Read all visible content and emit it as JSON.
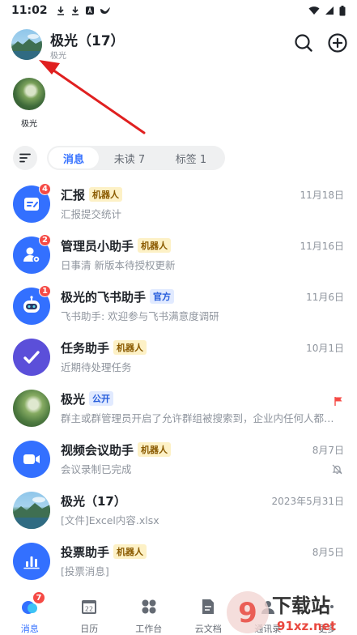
{
  "status_bar": {
    "time": "11:02"
  },
  "header": {
    "title": "极光（17）",
    "subtitle": "极光"
  },
  "story": {
    "name": "极光"
  },
  "filter": {
    "tabs": [
      {
        "label": "消息",
        "active": true
      },
      {
        "label": "未读 7",
        "active": false
      },
      {
        "label": "标签 1",
        "active": false
      }
    ]
  },
  "chats": [
    {
      "name": "汇报",
      "tag": "机器人",
      "date": "11月18日",
      "preview": "汇报提交统计",
      "badge": "4",
      "icon": "report-icon",
      "color": "#3370ff"
    },
    {
      "name": "管理员小助手",
      "tag": "机器人",
      "date": "11月16日",
      "preview": "日事清 新版本待授权更新",
      "badge": "2",
      "icon": "admin-settings-icon",
      "color": "#3370ff"
    },
    {
      "name": "极光的飞书助手",
      "tag": "官方",
      "date": "11月6日",
      "preview": "飞书助手: 欢迎参与飞书满意度调研",
      "badge": "1",
      "icon": "robot-icon",
      "color": "#3370ff"
    },
    {
      "name": "任务助手",
      "tag": "机器人",
      "date": "10月1日",
      "preview": "近期待处理任务",
      "icon": "check-icon",
      "color": "#5b4fd9"
    },
    {
      "name": "极光",
      "tag": "公开",
      "date": "",
      "preview": "群主或群管理员开启了允许群组被搜索到，企业内任何人都可以搜索到该群组",
      "icon": "group-avatar",
      "color": "#5c8a3c"
    },
    {
      "name": "视频会议助手",
      "tag": "机器人",
      "date": "8月7日",
      "preview": "会议录制已完成",
      "icon": "video-icon",
      "color": "#3370ff"
    },
    {
      "name": "极光（17）",
      "tag": "",
      "date": "2023年5月31日",
      "preview": "[文件]Excel内容.xlsx",
      "icon": "landscape-avatar",
      "color": "#4a8ab8"
    },
    {
      "name": "投票助手",
      "tag": "机器人",
      "date": "8月5日",
      "preview": "[投票消息]",
      "icon": "vote-icon",
      "color": "#3370ff"
    }
  ],
  "bottom_nav": [
    {
      "label": "消息",
      "badge": "7",
      "active": true
    },
    {
      "label": "日历",
      "badge": "",
      "active": false,
      "icon_text": "22"
    },
    {
      "label": "工作台",
      "badge": "",
      "active": false
    },
    {
      "label": "云文档",
      "badge": "",
      "active": false
    },
    {
      "label": "通讯录",
      "badge": "",
      "active": false
    },
    {
      "label": "更多",
      "badge": "",
      "active": false
    }
  ],
  "watermark": {
    "text": "下载站",
    "domain": "91xz.net"
  }
}
